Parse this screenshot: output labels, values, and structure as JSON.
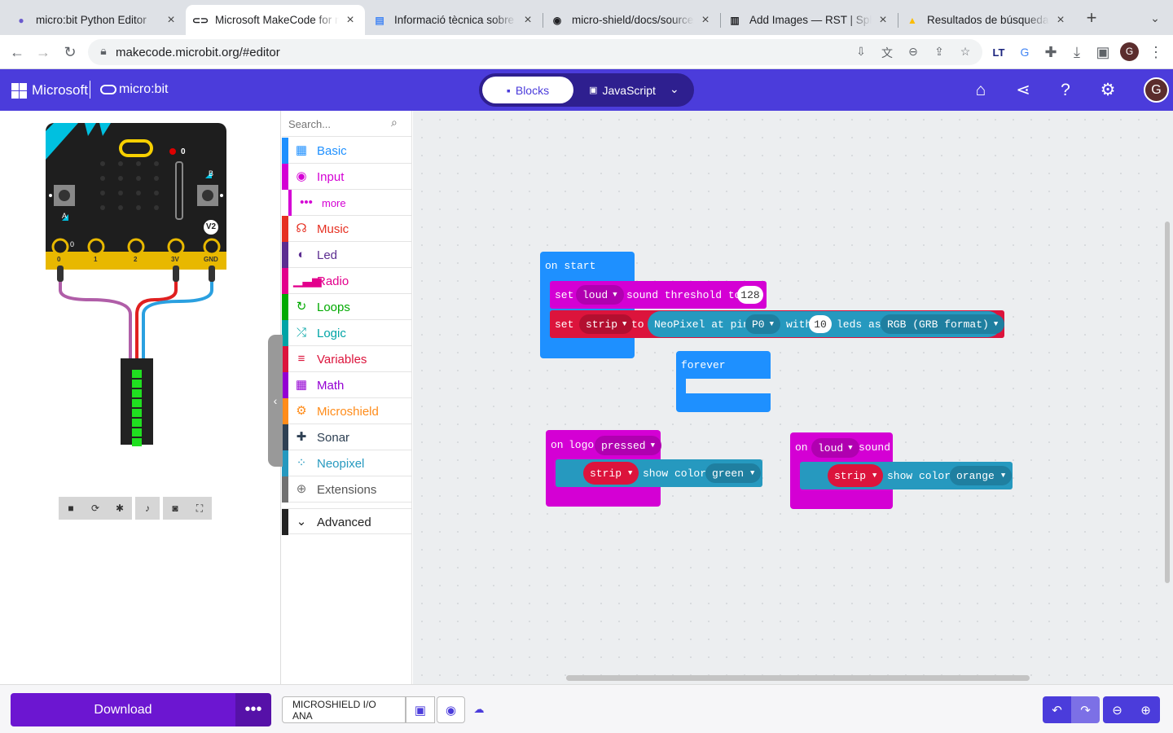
{
  "browser": {
    "tabs": [
      {
        "title": "micro:bit Python Editor",
        "icon": "python-icon"
      },
      {
        "title": "Microsoft MakeCode for micro:bit",
        "icon": "makecode-icon"
      },
      {
        "title": "Informació tècnica sobre la",
        "icon": "docs-icon"
      },
      {
        "title": "micro-shield/docs/source/",
        "icon": "github-icon"
      },
      {
        "title": "Add Images — RST | Sphinx",
        "icon": "book-icon"
      },
      {
        "title": "Resultados de búsqueda -",
        "icon": "drive-icon"
      }
    ],
    "url": "makecode.microbit.org/#editor",
    "profile_initial": "G"
  },
  "header": {
    "ms_label": "Microsoft",
    "mb_label": "micro:bit",
    "blocks_label": "Blocks",
    "js_label": "JavaScript",
    "avatar_initial": "G"
  },
  "simulator": {
    "pins": [
      "0",
      "1",
      "2",
      "3V",
      "GND"
    ],
    "button_a": "A",
    "button_b": "B",
    "version_badge": "V2",
    "mic_level": "0",
    "pin0_value": "0"
  },
  "toolbox": {
    "search_placeholder": "Search...",
    "categories": [
      {
        "label": "Basic",
        "color": "#1e90ff",
        "icon": "grid-icon"
      },
      {
        "label": "Input",
        "color": "#d400d4",
        "icon": "input-icon"
      },
      {
        "label": "more",
        "color": "#d400d4",
        "icon": "dots-icon"
      },
      {
        "label": "Music",
        "color": "#e63022",
        "icon": "headphones-icon"
      },
      {
        "label": "Led",
        "color": "#5c2d91",
        "icon": "toggle-icon"
      },
      {
        "label": "Radio",
        "color": "#e3008c",
        "icon": "signal-icon"
      },
      {
        "label": "Loops",
        "color": "#00aa00",
        "icon": "loop-icon"
      },
      {
        "label": "Logic",
        "color": "#00a4a6",
        "icon": "shuffle-icon"
      },
      {
        "label": "Variables",
        "color": "#dc143c",
        "icon": "list-icon"
      },
      {
        "label": "Math",
        "color": "#9400d3",
        "icon": "calculator-icon"
      },
      {
        "label": "Microshield",
        "color": "#ff8c1a",
        "icon": "gears-icon"
      },
      {
        "label": "Sonar",
        "color": "#2e4053",
        "icon": "puzzle-icon"
      },
      {
        "label": "Neopixel",
        "color": "#2699bf",
        "icon": "neopixel-icon"
      },
      {
        "label": "Extensions",
        "color": "#717171",
        "icon": "plus-circle-icon"
      }
    ],
    "advanced_label": "Advanced"
  },
  "blocks": {
    "on_start": "on start",
    "set1_set": "set",
    "set1_var": "loud",
    "set1_mid": "sound threshold to",
    "set1_value": "128",
    "set2_set": "set",
    "set2_var": "strip",
    "set2_to": "to",
    "set2_neo": "NeoPixel at pin",
    "set2_pin": "P0",
    "set2_with": "with",
    "set2_count": "10",
    "set2_leds": "leds as",
    "set2_format": "RGB (GRB format)",
    "forever": "forever",
    "logo_on": "on",
    "logo_label": "logo",
    "logo_event": "pressed",
    "logo_strip": "strip",
    "logo_show": "show color",
    "logo_color": "green",
    "sound_on": "on",
    "sound_level": "loud",
    "sound_label": "sound",
    "sound_strip": "strip",
    "sound_show": "show color",
    "sound_color": "orange"
  },
  "bottom": {
    "download_label": "Download",
    "more_label": "•••",
    "project_name": "MICROSHIELD I/O ANA"
  },
  "colors": {
    "header": "#4b3cdb",
    "event_block": "#1e90ff",
    "input_block": "#d400d4",
    "variable_block": "#dc143c",
    "neopixel_block": "#2699bf",
    "download": "#6c16d1"
  }
}
